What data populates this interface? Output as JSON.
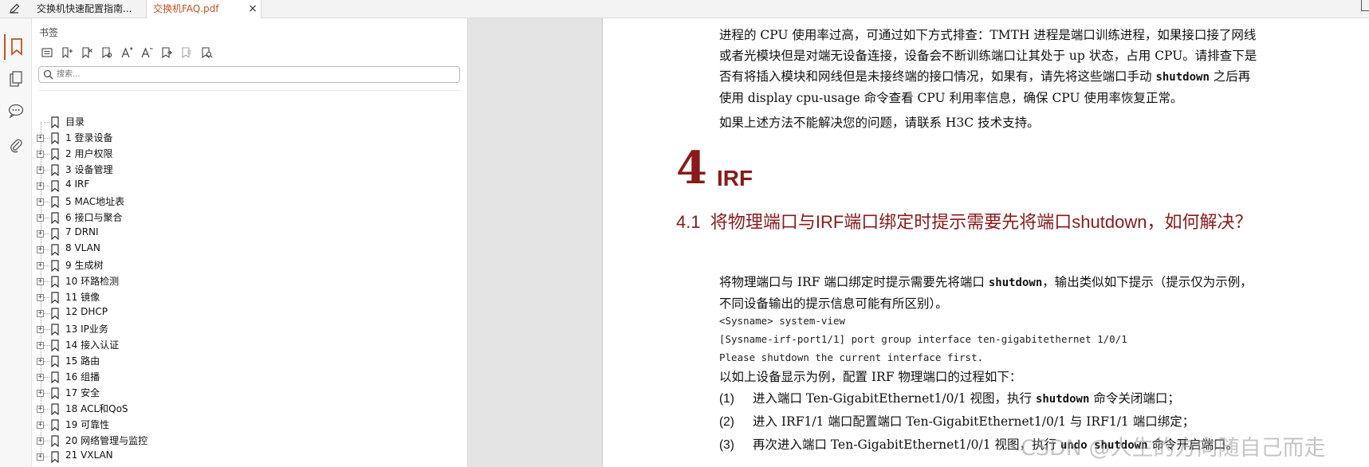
{
  "tabs": [
    {
      "label": "交换机快速配置指南..."
    },
    {
      "label": "交换机FAQ.pdf"
    }
  ],
  "tab_close": "×",
  "colors": {
    "accent": "#c8511f",
    "heading": "#8b1a1a"
  },
  "rail_icons": [
    "bookmark-icon",
    "pages-icon",
    "comment-icon",
    "attachment-icon"
  ],
  "panel": {
    "title": "书签",
    "toolbar_icons": [
      "expand-all-icon",
      "new-bookmark-icon",
      "delete-bookmark-icon",
      "bookmark-properties-icon",
      "font-larger-icon",
      "font-smaller-icon",
      "wrap-icon",
      "tag-icon",
      "find-bookmark-icon"
    ],
    "search_placeholder": "搜索...",
    "bookmarks": [
      {
        "label": "目录"
      },
      {
        "label": "1 登录设备"
      },
      {
        "label": "2 用户权限"
      },
      {
        "label": "3 设备管理"
      },
      {
        "label": "4 IRF"
      },
      {
        "label": "5 MAC地址表"
      },
      {
        "label": "6 接口与聚合"
      },
      {
        "label": "7 DRNI"
      },
      {
        "label": "8 VLAN"
      },
      {
        "label": "9 生成树"
      },
      {
        "label": "10 环路检测"
      },
      {
        "label": "11 镜像"
      },
      {
        "label": "12 DHCP"
      },
      {
        "label": "13 IP业务"
      },
      {
        "label": "14 接入认证"
      },
      {
        "label": "15 路由"
      },
      {
        "label": "16 组播"
      },
      {
        "label": "17 安全"
      },
      {
        "label": "18 ACL和QoS"
      },
      {
        "label": "19 可靠性"
      },
      {
        "label": "20 网络管理与监控"
      },
      {
        "label": "21 VXLAN"
      }
    ]
  },
  "document": {
    "intro": {
      "line1": "进程的 CPU 使用率过高，可通过如下方式排查：TMTH 进程是端口训练进程，如果接口接了网线",
      "line2": "或者光模块但是对端无设备连接，设备会不断训练端口让其处于 up 状态，占用 CPU。请排查下是",
      "line3a": "否有将插入模块和网线但是未接终端的接口情况，如果有，请先将这些端口手动 ",
      "line3_cmd": "shutdown",
      "line3b": " 之后再",
      "line4": "使用 display cpu-usage 命令查看 CPU 利用率信息，确保 CPU 使用率恢复正常。"
    },
    "contact": "如果上述方法不能解决您的问题，请联系 H3C 技术支持。",
    "chapter_number": "4",
    "chapter_title": "IRF",
    "section_number": "4.1",
    "section_title": "将物理端口与IRF端口绑定时提示需要先将端口shutdown，如何解决？",
    "body": {
      "line1a": "将物理端口与 IRF 端口绑定时提示需要先将端口 ",
      "line1_cmd": "shutdown",
      "line1b": "，输出类似如下提示（提示仅为示例，",
      "line2": "不同设备输出的提示信息可能有所区别）。"
    },
    "code_lines": [
      "<Sysname> system-view",
      "[Sysname-irf-port1/1] port group interface ten-gigabitethernet 1/0/1",
      "Please shutdown the current interface first."
    ],
    "process_intro": "以如上设备显示为例，配置 IRF 物理端口的过程如下：",
    "steps": [
      {
        "num": "(1)",
        "pre": "进入端口 Ten-GigabitEthernet1/0/1 视图，执行 ",
        "cmd": "shutdown",
        "post": " 命令关闭端口；"
      },
      {
        "num": "(2)",
        "pre": "进入 IRF1/1 端口配置端口 Ten-GigabitEthernet1/0/1 与 IRF1/1 端口绑定；",
        "cmd": "",
        "post": ""
      },
      {
        "num": "(3)",
        "pre": "再次进入端口 Ten-GigabitEthernet1/0/1 视图，执行 ",
        "cmd": "undo shutdown",
        "post": " 命令开启端口。"
      }
    ]
  },
  "watermark": "CSDN @人生的方向随自己而走"
}
